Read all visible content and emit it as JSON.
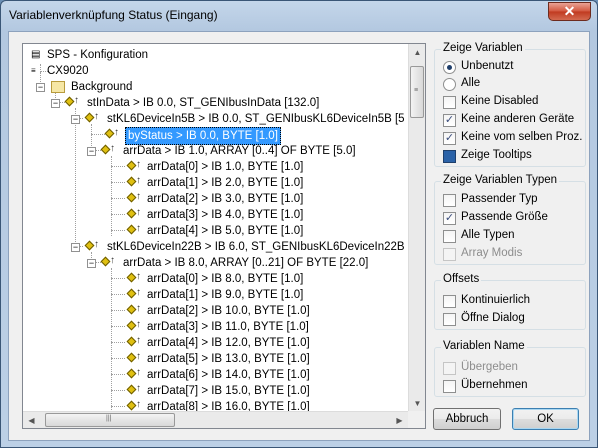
{
  "window": {
    "title": "Variablenverknüpfung Status (Eingang)",
    "close_glyph": "✕"
  },
  "tree": {
    "rows": [
      {
        "text": "SPS - Konfiguration"
      },
      {
        "text": "CX9020"
      },
      {
        "text": "Background"
      },
      {
        "text": "stInData    >   IB 0.0, ST_GENIbusInData [132.0]"
      },
      {
        "text": "stKL6DeviceIn5B    >   IB 0.0, ST_GENIbusKL6DeviceIn5B [5"
      },
      {
        "text": "byStatus    >   IB 0.0, BYTE [1.0]"
      },
      {
        "text": "arrData    >   IB 1.0, ARRAY [0..4] OF BYTE [5.0]"
      },
      {
        "text": "arrData[0]    >   IB 1.0, BYTE [1.0]"
      },
      {
        "text": "arrData[1]    >   IB 2.0, BYTE [1.0]"
      },
      {
        "text": "arrData[2]    >   IB 3.0, BYTE [1.0]"
      },
      {
        "text": "arrData[3]    >   IB 4.0, BYTE [1.0]"
      },
      {
        "text": "arrData[4]    >   IB 5.0, BYTE [1.0]"
      },
      {
        "text": "stKL6DeviceIn22B    >   IB 6.0, ST_GENIbusKL6DeviceIn22B"
      },
      {
        "text": "arrData    >   IB 8.0, ARRAY [0..21] OF BYTE [22.0]"
      },
      {
        "text": "arrData[0]    >   IB 8.0, BYTE [1.0]"
      },
      {
        "text": "arrData[1]    >   IB 9.0, BYTE [1.0]"
      },
      {
        "text": "arrData[2]    >   IB 10.0, BYTE [1.0]"
      },
      {
        "text": "arrData[3]    >   IB 11.0, BYTE [1.0]"
      },
      {
        "text": "arrData[4]    >   IB 12.0, BYTE [1.0]"
      },
      {
        "text": "arrData[5]    >   IB 13.0, BYTE [1.0]"
      },
      {
        "text": "arrData[6]    >   IB 14.0, BYTE [1.0]"
      },
      {
        "text": "arrData[7]    >   IB 15.0, BYTE [1.0]"
      },
      {
        "text": "arrData[8]    >   IB 16.0, BYTE [1.0]"
      }
    ]
  },
  "zeige_variablen": {
    "title": "Zeige Variablen",
    "unbenutzt": {
      "label": "Unbenutzt",
      "selected": true
    },
    "alle": {
      "label": "Alle",
      "selected": false
    },
    "keine_disabled": {
      "label": "Keine Disabled",
      "checked": false
    },
    "keine_anderen_geraete": {
      "label": "Keine anderen Geräte",
      "checked": true
    },
    "keine_vom_selben_proz": {
      "label": "Keine vom selben Proz.",
      "checked": true
    },
    "zeige_tooltips": {
      "label": "Zeige Tooltips",
      "checked": true
    }
  },
  "zeige_variablen_typen": {
    "title": "Zeige Variablen Typen",
    "passender_typ": {
      "label": "Passender Typ",
      "checked": false
    },
    "passende_groesse": {
      "label": "Passende Größe",
      "checked": true
    },
    "alle_typen": {
      "label": "Alle Typen",
      "checked": false
    },
    "array_modis": {
      "label": "Array Modis",
      "checked": false,
      "enabled": false
    }
  },
  "offsets": {
    "title": "Offsets",
    "kontinuierlich": {
      "label": "Kontinuierlich",
      "checked": false
    },
    "oeffne_dialog": {
      "label": "Öffne Dialog",
      "checked": false
    }
  },
  "variablen_name": {
    "title": "Variablen Name",
    "uebergeben": {
      "label": "Übergeben",
      "checked": false,
      "enabled": false
    },
    "uebernehmen": {
      "label": "Übernehmen",
      "checked": false
    }
  },
  "buttons": {
    "abbruch": "Abbruch",
    "ok": "OK"
  },
  "icons": {
    "check": "✓",
    "minus": "−",
    "plus": "+",
    "arrow_up": "▲",
    "arrow_down": "▼",
    "arrow_left": "◀",
    "arrow_right": "▶"
  },
  "colors": {
    "selection": "#3399ff",
    "accent": "#2a62a8"
  }
}
